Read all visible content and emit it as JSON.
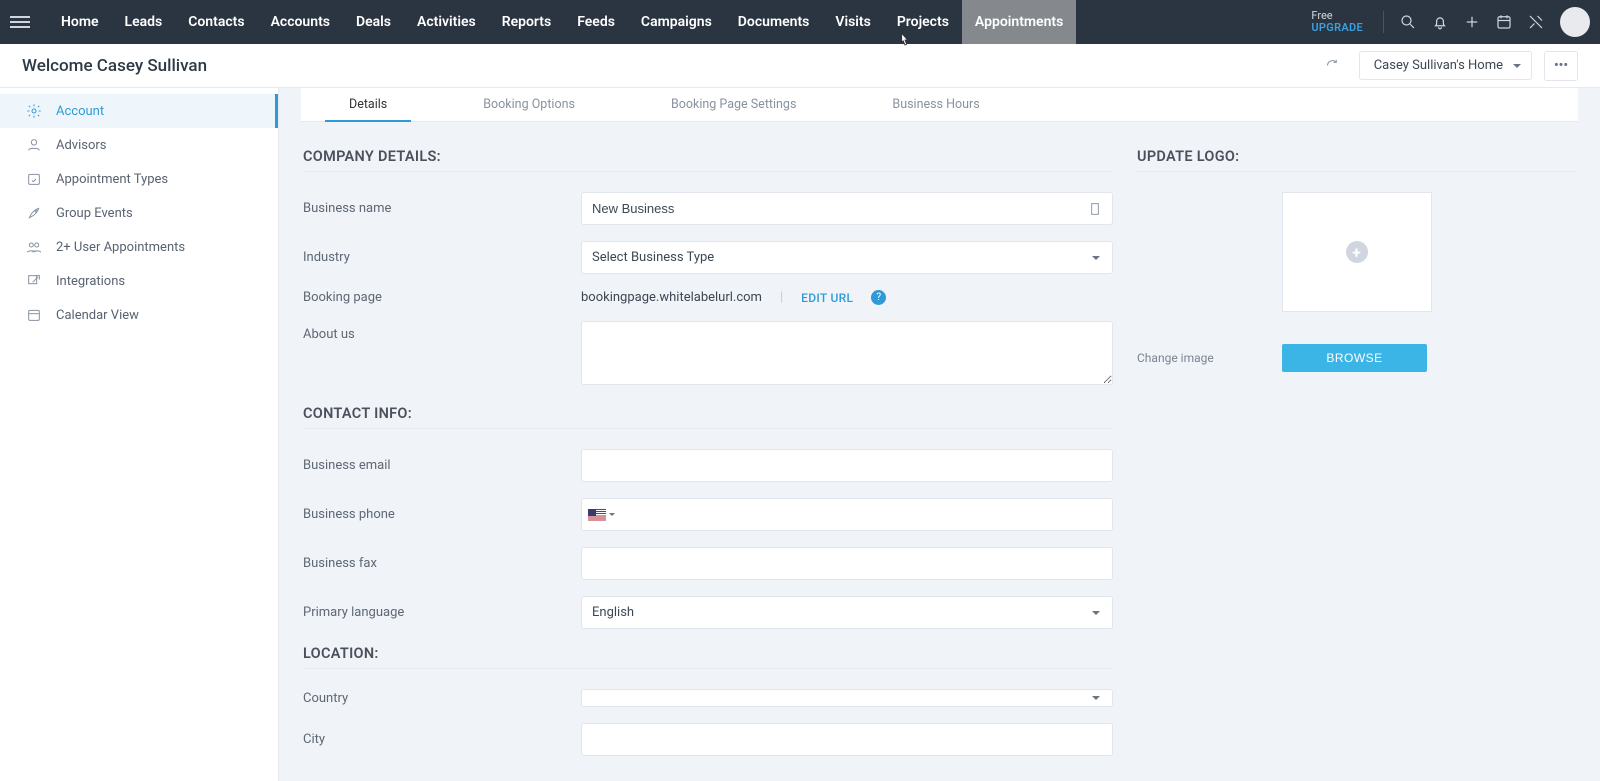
{
  "topnav": {
    "items": [
      "Home",
      "Leads",
      "Contacts",
      "Accounts",
      "Deals",
      "Activities",
      "Reports",
      "Feeds",
      "Campaigns",
      "Documents",
      "Visits",
      "Projects",
      "Appointments"
    ],
    "active": "Appointments",
    "plan": "Free",
    "upgrade": "UPGRADE"
  },
  "subheader": {
    "welcome": "Welcome Casey Sullivan",
    "home_dropdown": "Casey Sullivan's Home"
  },
  "sidebar": {
    "items": [
      {
        "label": "Account",
        "icon": "settings-gear"
      },
      {
        "label": "Advisors",
        "icon": "person"
      },
      {
        "label": "Appointment Types",
        "icon": "calendar-check"
      },
      {
        "label": "Group Events",
        "icon": "rocket"
      },
      {
        "label": "2+ User Appointments",
        "icon": "people"
      },
      {
        "label": "Integrations",
        "icon": "external"
      },
      {
        "label": "Calendar View",
        "icon": "calendar"
      }
    ],
    "active": 0
  },
  "tabs": {
    "items": [
      "Details",
      "Booking Options",
      "Booking Page Settings",
      "Business Hours"
    ],
    "active": 0
  },
  "sections": {
    "company": {
      "title": "COMPANY DETAILS:",
      "business_name_label": "Business name",
      "business_name_value": "New Business",
      "industry_label": "Industry",
      "industry_value": "Select Business Type",
      "booking_page_label": "Booking page",
      "booking_page_url": "bookingpage.whitelabelurl.com",
      "edit_url_label": "EDIT URL",
      "about_label": "About us",
      "about_value": ""
    },
    "contact": {
      "title": "CONTACT INFO:",
      "email_label": "Business email",
      "email_value": "",
      "phone_label": "Business phone",
      "phone_value": "",
      "fax_label": "Business fax",
      "fax_value": "",
      "lang_label": "Primary language",
      "lang_value": "English"
    },
    "location": {
      "title": "LOCATION:",
      "country_label": "Country",
      "country_value": "",
      "city_label": "City",
      "city_value": ""
    },
    "logo": {
      "title": "UPDATE LOGO:",
      "change_label": "Change image",
      "browse_label": "BROWSE"
    }
  }
}
